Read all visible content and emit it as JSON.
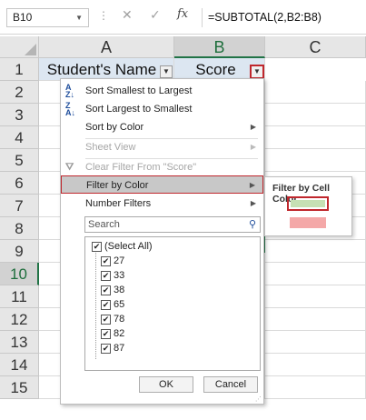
{
  "formula_bar": {
    "name_box": "B10",
    "formula": "=SUBTOTAL(2,B2:B8)",
    "fx_label": "fx"
  },
  "columns": [
    "A",
    "B",
    "C"
  ],
  "rows": [
    "1",
    "2",
    "3",
    "4",
    "5",
    "6",
    "7",
    "8",
    "9",
    "10",
    "11",
    "12",
    "13",
    "14",
    "15"
  ],
  "header_cells": {
    "a1": "Student's Name",
    "b1": "Score"
  },
  "selected_cell": "B10",
  "menu": {
    "sort_smallest": "Sort Smallest to Largest",
    "sort_largest": "Sort Largest to Smallest",
    "sort_by_color": "Sort by Color",
    "sheet_view": "Sheet View",
    "clear_filter": "Clear Filter From \"Score\"",
    "filter_by_color": "Filter by Color",
    "number_filters": "Number Filters",
    "search_placeholder": "Search",
    "list": [
      "(Select All)",
      "27",
      "33",
      "38",
      "65",
      "78",
      "82",
      "87"
    ],
    "ok": "OK",
    "cancel": "Cancel"
  },
  "submenu": {
    "title": "Filter by Cell Color",
    "colors": [
      "#c6e0b4",
      "#f4a8a8"
    ]
  },
  "colors": {
    "header_fill": "#dce6f1",
    "accent": "#217346",
    "highlight": "#c0272d"
  }
}
